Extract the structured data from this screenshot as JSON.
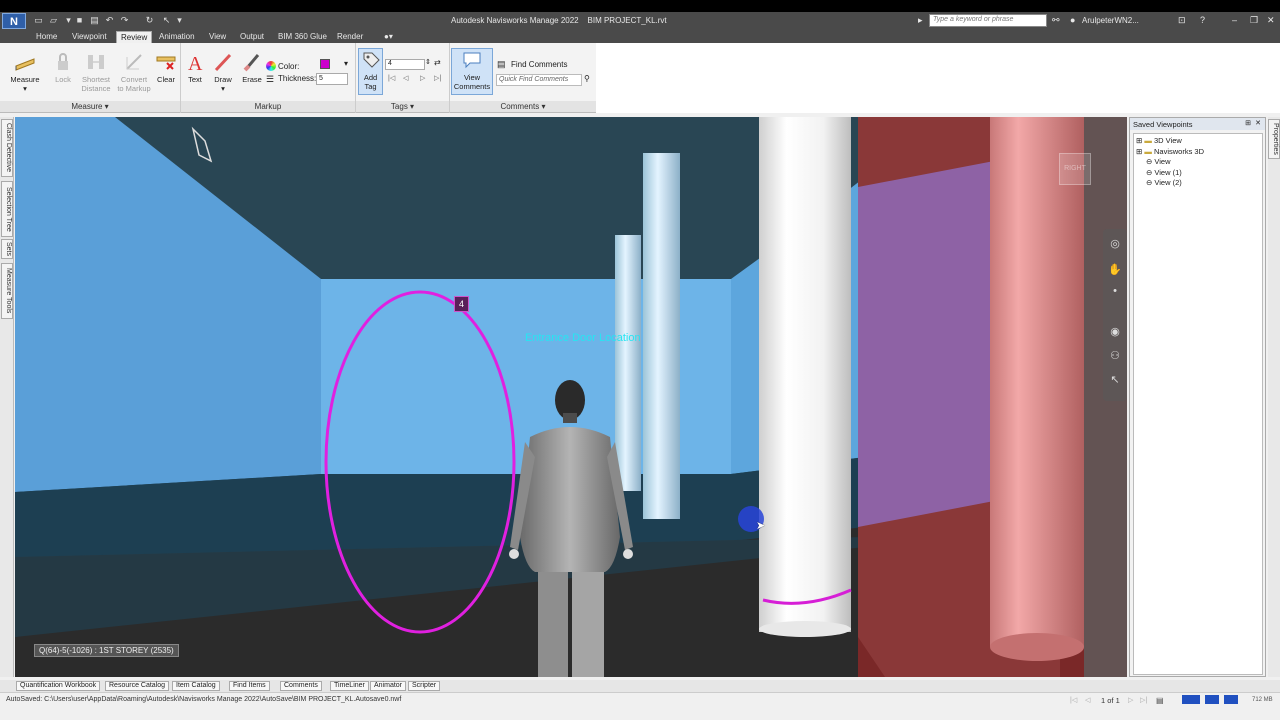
{
  "window": {
    "title": "Autodesk Navisworks Manage 2022",
    "file": "BIM PROJECT_KL.rvt",
    "search_placeholder": "Type a keyword or phrase",
    "user": "ArulpeterWN2...",
    "logo": "N"
  },
  "menu": {
    "tabs": [
      "Home",
      "Viewpoint",
      "Review",
      "Animation",
      "View",
      "Output",
      "BIM 360 Glue",
      "Render"
    ],
    "active": "Review"
  },
  "ribbon": {
    "measure": {
      "measure": "Measure",
      "lock": "Lock",
      "shortest_1": "Shortest",
      "shortest_2": "Distance",
      "convert_1": "Convert",
      "convert_2": "to Markup",
      "clear": "Clear",
      "panel": "Measure"
    },
    "markup": {
      "text": "Text",
      "draw": "Draw",
      "erase": "Erase",
      "color_label": "Color:",
      "thickness_label": "Thickness:",
      "thickness_value": "5",
      "panel": "Markup",
      "color_value": "#cc00cc"
    },
    "tags": {
      "add_1": "Add",
      "add_2": "Tag",
      "tag_value": "4",
      "panel": "Tags"
    },
    "comments": {
      "view_1": "View",
      "view_2": "Comments",
      "find": "Find Comments",
      "quick_find_placeholder": "Quick Find Comments",
      "panel": "Comments"
    }
  },
  "left_tabs": [
    "Clash Detective",
    "Selection Tree",
    "Sets",
    "Measure Tools"
  ],
  "right_tabs": [
    "Properties"
  ],
  "saved_viewpoints": {
    "title": "Saved Viewpoints",
    "items": [
      {
        "label": "3D View",
        "type": "folder"
      },
      {
        "label": "Navisworks 3D",
        "type": "folder"
      },
      {
        "label": "View",
        "type": "viewpoint"
      },
      {
        "label": "View (1)",
        "type": "viewpoint"
      },
      {
        "label": "View (2)",
        "type": "viewpoint"
      }
    ]
  },
  "viewport": {
    "annotation": "Entrance Door Location",
    "tag_number": "4",
    "location": "Q(64)-5(-1026) : 1ST STOREY (2535)",
    "viewcube_face": "RIGHT"
  },
  "bottom_tabs": [
    "Quantification Workbook",
    "Resource Catalog",
    "Item Catalog",
    "Find Items",
    "Comments",
    "TimeLiner",
    "Animator",
    "Scripter"
  ],
  "status": {
    "autosave": "AutoSaved: C:\\Users\\user\\AppData\\Roaming\\Autodesk\\Navisworks Manage 2022\\AutoSave\\BIM PROJECT_KL.Autosave0.nwf",
    "page": "1 of 1",
    "memory": "712 MB"
  }
}
